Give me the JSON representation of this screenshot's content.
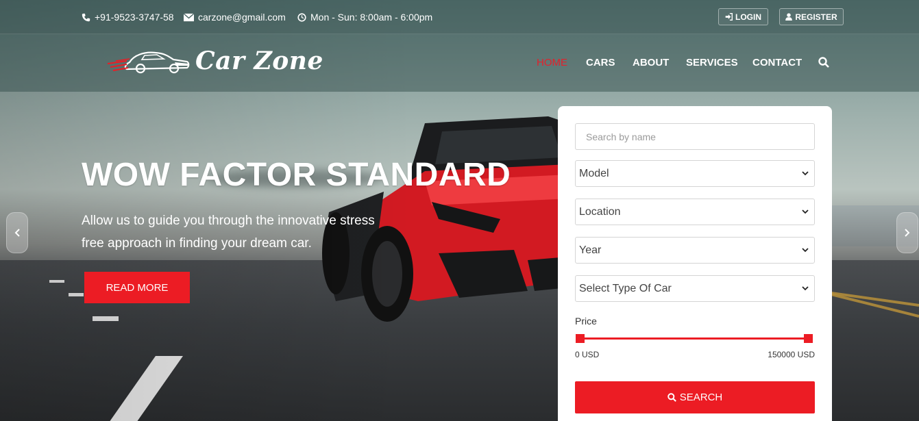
{
  "topbar": {
    "phone": "+91-9523-3747-58",
    "email": "carzone@gmail.com",
    "hours": "Mon - Sun: 8:00am - 6:00pm",
    "login_label": "LOGIN",
    "register_label": "REGISTER"
  },
  "brand": {
    "name": "Car Zone"
  },
  "nav": {
    "items": [
      {
        "label": "HOME",
        "active": true
      },
      {
        "label": "CARS"
      },
      {
        "label": "ABOUT"
      },
      {
        "label": "SERVICES"
      },
      {
        "label": "CONTACT"
      }
    ]
  },
  "hero": {
    "title": "WOW FACTOR STANDARD",
    "subtitle_line1": "Allow us to guide you through the innovative stress",
    "subtitle_line2": "free approach in finding your dream car.",
    "cta_label": "READ MORE"
  },
  "search_panel": {
    "name_placeholder": "Search by name",
    "model_value": "Model",
    "location_value": "Location",
    "year_value": "Year",
    "type_value": "Select Type Of Car",
    "price_label": "Price",
    "price_min": "0 USD",
    "price_max": "150000 USD",
    "price_range_fraction": [
      0,
      1
    ],
    "search_label": "SEARCH"
  },
  "colors": {
    "accent": "#ec1c24",
    "nav_active": "#e3212c",
    "panel_bg": "#ffffff"
  },
  "icons": {
    "phone": "phone-icon",
    "email": "envelope-icon",
    "hours": "clock-icon",
    "login": "sign-in-icon",
    "register": "user-icon",
    "nav_search": "search-icon",
    "carousel_prev": "chevron-left-icon",
    "carousel_next": "chevron-right-icon"
  }
}
